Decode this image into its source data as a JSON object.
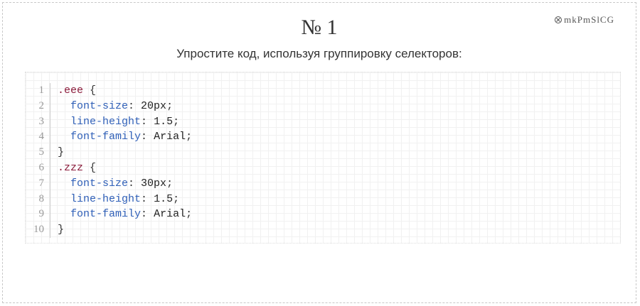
{
  "task": {
    "title": "№ 1",
    "subtitle": "Упростите код, используя группировку селекторов:",
    "id_icon": "circle-x-icon",
    "id_code": "mkPmSlCG"
  },
  "code": {
    "line_numbers": [
      "1",
      "2",
      "3",
      "4",
      "5",
      "6",
      "7",
      "8",
      "9",
      "10"
    ],
    "rule1": {
      "selector": ".eee",
      "open": " {",
      "decls": [
        {
          "prop": "font-size",
          "value": "20px"
        },
        {
          "prop": "line-height",
          "value": "1.5"
        },
        {
          "prop": "font-family",
          "value": "Arial"
        }
      ],
      "close": "}"
    },
    "rule2": {
      "selector": ".zzz",
      "open": " {",
      "decls": [
        {
          "prop": "font-size",
          "value": "30px"
        },
        {
          "prop": "line-height",
          "value": "1.5"
        },
        {
          "prop": "font-family",
          "value": "Arial"
        }
      ],
      "close": "}"
    }
  },
  "colors": {
    "selector": "#8b1a3a",
    "property": "#3060b8",
    "text": "#222222"
  }
}
